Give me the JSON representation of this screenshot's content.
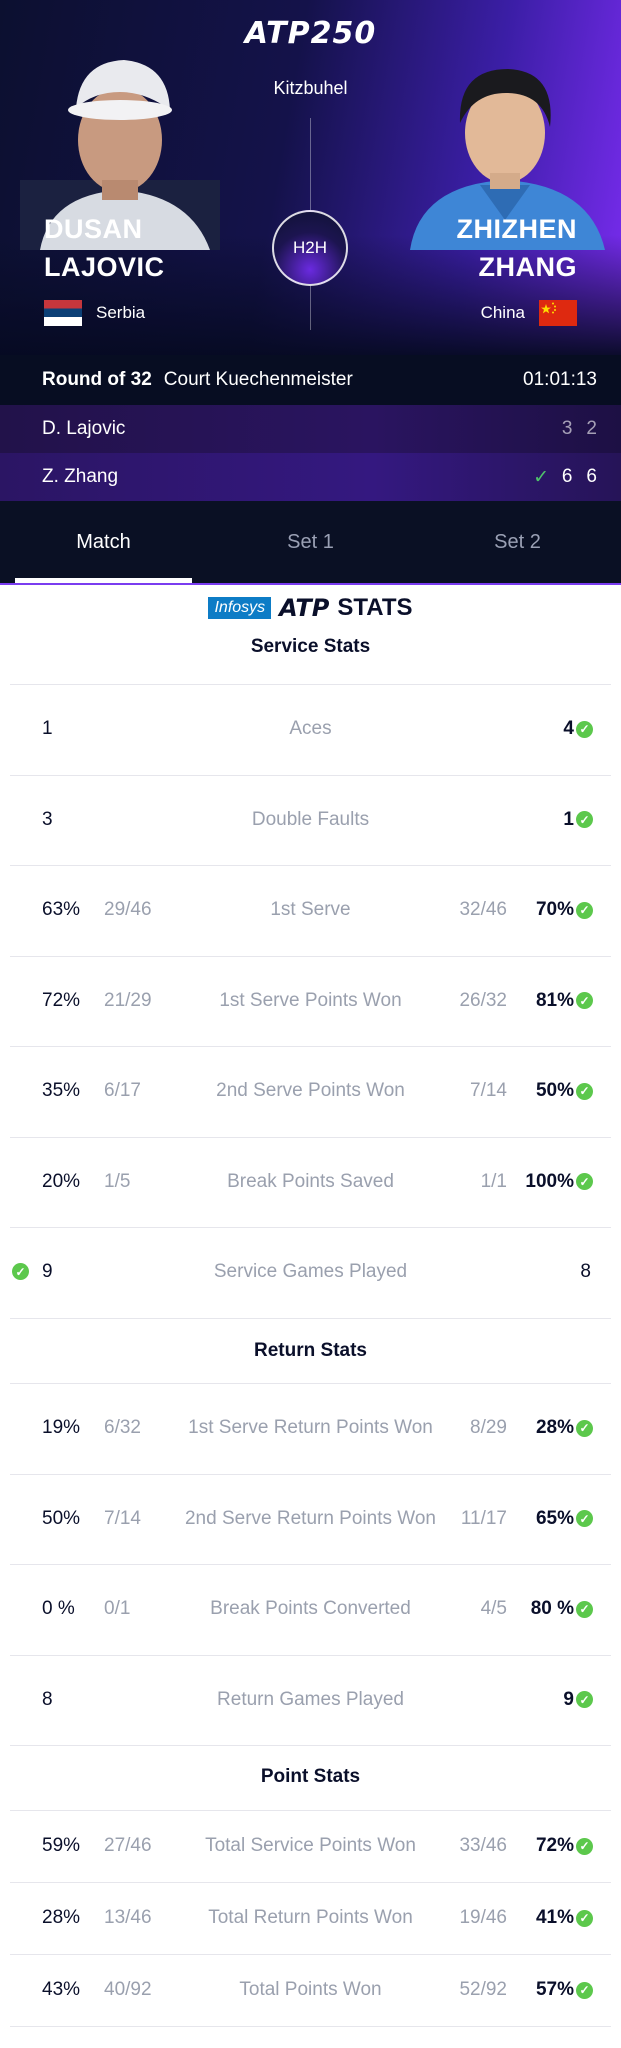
{
  "header": {
    "logo": "ATP250",
    "tournament": "Kitzbuhel",
    "h2h_label": "H2H"
  },
  "player1": {
    "first": "DUSAN",
    "last": "LAJOVIC",
    "country": "Serbia",
    "short": "D. Lajovic",
    "sets": [
      "3",
      "2"
    ]
  },
  "player2": {
    "first": "ZHIZHEN",
    "last": "ZHANG",
    "country": "China",
    "short": "Z. Zhang",
    "sets": [
      "6",
      "6"
    ]
  },
  "match": {
    "round": "Round of 32",
    "court": "Court Kuechenmeister",
    "duration": "01:01:13"
  },
  "tabs": [
    "Match",
    "Set 1",
    "Set 2"
  ],
  "sponsor": {
    "infosys": "Infosys",
    "atp": "ATP",
    "stats": "STATS"
  },
  "sections": {
    "service": "Service Stats",
    "return": "Return Stats",
    "point": "Point Stats"
  },
  "service_stats": [
    {
      "label": "Aces",
      "p1": "1",
      "p1f": "",
      "p2": "4",
      "p2f": "",
      "winner": "p2"
    },
    {
      "label": "Double Faults",
      "p1": "3",
      "p1f": "",
      "p2": "1",
      "p2f": "",
      "winner": "p2"
    },
    {
      "label": "1st Serve",
      "p1": "63%",
      "p1f": "29/46",
      "p2": "70%",
      "p2f": "32/46",
      "winner": "p2"
    },
    {
      "label": "1st Serve Points Won",
      "p1": "72%",
      "p1f": "21/29",
      "p2": "81%",
      "p2f": "26/32",
      "winner": "p2"
    },
    {
      "label": "2nd Serve Points Won",
      "p1": "35%",
      "p1f": "6/17",
      "p2": "50%",
      "p2f": "7/14",
      "winner": "p2"
    },
    {
      "label": "Break Points Saved",
      "p1": "20%",
      "p1f": "1/5",
      "p2": "100%",
      "p2f": "1/1",
      "winner": "p2"
    },
    {
      "label": "Service Games Played",
      "p1": "9",
      "p1f": "",
      "p2": "8",
      "p2f": "",
      "winner": "p1"
    }
  ],
  "return_stats": [
    {
      "label": "1st Serve Return Points Won",
      "p1": "19%",
      "p1f": "6/32",
      "p2": "28%",
      "p2f": "8/29",
      "winner": "p2"
    },
    {
      "label": "2nd Serve Return Points Won",
      "p1": "50%",
      "p1f": "7/14",
      "p2": "65%",
      "p2f": "11/17",
      "winner": "p2"
    },
    {
      "label": "Break Points Converted",
      "p1": "0 %",
      "p1f": "0/1",
      "p2": "80 %",
      "p2f": "4/5",
      "winner": "p2"
    },
    {
      "label": "Return Games Played",
      "p1": "8",
      "p1f": "",
      "p2": "9",
      "p2f": "",
      "winner": "p2"
    }
  ],
  "point_stats": [
    {
      "label": "Total Service Points Won",
      "p1": "59%",
      "p1f": "27/46",
      "p2": "72%",
      "p2f": "33/46",
      "winner": "p2"
    },
    {
      "label": "Total Return Points Won",
      "p1": "28%",
      "p1f": "13/46",
      "p2": "41%",
      "p2f": "19/46",
      "winner": "p2"
    },
    {
      "label": "Total Points Won",
      "p1": "43%",
      "p1f": "40/92",
      "p2": "57%",
      "p2f": "52/92",
      "winner": "p2"
    }
  ]
}
